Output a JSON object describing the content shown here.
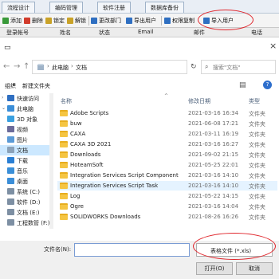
{
  "app": {
    "tabs": [
      "流程设计",
      "编码管理",
      "软件注册",
      "数据库备份"
    ],
    "toolbar": [
      {
        "label": "添加",
        "color": "#3a9a3a"
      },
      {
        "label": "删除",
        "color": "#d13b2b"
      },
      {
        "label": "锁定",
        "color": "#c9a227"
      },
      {
        "label": "解锁",
        "color": "#c9a227"
      },
      {
        "label": "更改部门",
        "color": "#2f6fc1"
      },
      {
        "label": "导出用户",
        "color": "#2f6fc1"
      },
      {
        "label": "权限复制",
        "color": "#2f6fc1"
      },
      {
        "label": "导入用户",
        "color": "#2f6fc1"
      }
    ],
    "columns": [
      "登录帐号",
      "姓名",
      "状态",
      "Email",
      "邮件",
      "电话"
    ]
  },
  "dialog": {
    "close_glyph": "×",
    "nav": {
      "back": "←",
      "forward": "→",
      "up": "↑"
    },
    "breadcrumb": [
      "此电脑",
      "文档"
    ],
    "search_placeholder": "搜索\"文档\"",
    "organize_label": "组织",
    "new_folder_label": "新建文件夹",
    "sidebar": [
      {
        "label": "快速访问",
        "icon": "star-icon",
        "color": "#2f6fc1"
      },
      {
        "label": "此电脑",
        "icon": "computer-icon",
        "color": "#3b8ed8"
      },
      {
        "label": "3D 对象",
        "icon": "cube-icon",
        "color": "#3aa0e0"
      },
      {
        "label": "视频",
        "icon": "video-icon",
        "color": "#6b6b9a"
      },
      {
        "label": "图片",
        "icon": "picture-icon",
        "color": "#5a9ad6"
      },
      {
        "label": "文档",
        "icon": "document-icon",
        "color": "#8aa1b8",
        "selected": true
      },
      {
        "label": "下载",
        "icon": "download-icon",
        "color": "#2a7fd4"
      },
      {
        "label": "音乐",
        "icon": "music-icon",
        "color": "#3a8fd8"
      },
      {
        "label": "桌面",
        "icon": "desktop-icon",
        "color": "#3b8ed8"
      },
      {
        "label": "系统 (C:)",
        "icon": "drive-icon",
        "color": "#7d8fa3"
      },
      {
        "label": "软件 (D:)",
        "icon": "drive-icon",
        "color": "#7d8fa3"
      },
      {
        "label": "文档 (E:)",
        "icon": "drive-icon",
        "color": "#7d8fa3"
      },
      {
        "label": "工程数管 (F:)",
        "icon": "drive-icon",
        "color": "#7d8fa3"
      }
    ],
    "columns": {
      "name": "名称",
      "date": "修改日期",
      "type": "类型"
    },
    "files": [
      {
        "name": "Adobe Scripts",
        "date": "2021-03-16 16:34",
        "type": "文件夹"
      },
      {
        "name": "buw",
        "date": "2021-06-08 17:21",
        "type": "文件夹"
      },
      {
        "name": "CAXA",
        "date": "2021-03-11 16:19",
        "type": "文件夹"
      },
      {
        "name": "CAXA 3D 2021",
        "date": "2021-03-16 16:27",
        "type": "文件夹"
      },
      {
        "name": "Downloads",
        "date": "2021-09-02 21:15",
        "type": "文件夹"
      },
      {
        "name": "HoteamSoft",
        "date": "2021-05-25 22:01",
        "type": "文件夹"
      },
      {
        "name": "Integration Services Script Component",
        "date": "2021-03-16 14:10",
        "type": "文件夹"
      },
      {
        "name": "Integration Services Script Task",
        "date": "2021-03-16 14:10",
        "type": "文件夹",
        "highlight": true
      },
      {
        "name": "Log",
        "date": "2021-05-22 14:15",
        "type": "文件夹"
      },
      {
        "name": "Ogre",
        "date": "2021-03-16 14:04",
        "type": "文件夹"
      },
      {
        "name": "SOLIDWORKS Downloads",
        "date": "2021-08-26 16:26",
        "type": "文件夹"
      }
    ],
    "filename_label": "文件名(N):",
    "filename_value": "",
    "filetype": "表格文件 (*.xls)",
    "open_label": "打开(O)",
    "cancel_label": "取消"
  },
  "colors": {
    "accent": "#2f6fc1",
    "selection": "#cce8ff",
    "highlight_circle": "#e0262c",
    "folder": "#f5c542"
  }
}
